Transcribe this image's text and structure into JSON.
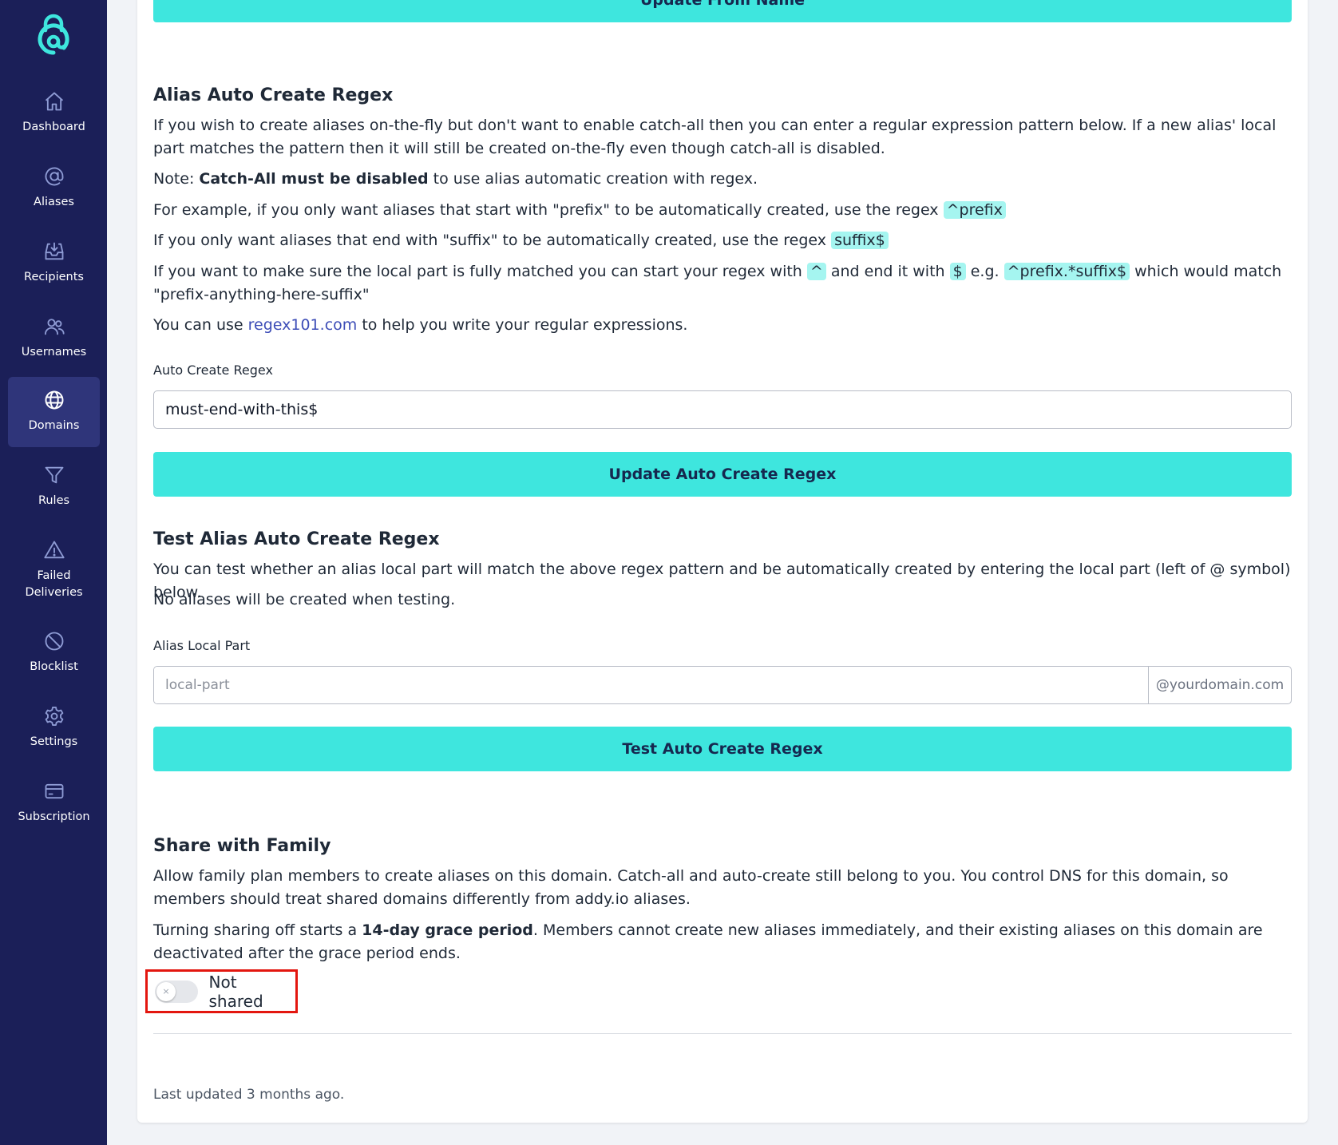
{
  "sidebar": {
    "logo": "addy-logo",
    "items": [
      {
        "label": "Dashboard",
        "icon": "home-icon"
      },
      {
        "label": "Aliases",
        "icon": "at-icon"
      },
      {
        "label": "Recipients",
        "icon": "inbox-icon"
      },
      {
        "label": "Usernames",
        "icon": "users-icon"
      },
      {
        "label": "Domains",
        "icon": "globe-icon",
        "active": true
      },
      {
        "label": "Rules",
        "icon": "funnel-icon"
      },
      {
        "label": "Failed Deliveries",
        "icon": "warning-icon"
      },
      {
        "label": "Blocklist",
        "icon": "ban-icon"
      },
      {
        "label": "Settings",
        "icon": "gear-icon"
      },
      {
        "label": "Subscription",
        "icon": "card-icon"
      }
    ]
  },
  "top_button": {
    "label": "Update From Name"
  },
  "auto_create": {
    "title": "Alias Auto Create Regex",
    "p1": "If you wish to create aliases on-the-fly but don't want to enable catch-all then you can enter a regular expression pattern below. If a new alias' local part matches the pattern then it will still be created on-the-fly even though catch-all is disabled.",
    "p2_prefix": "Note: ",
    "p2_bold": "Catch-All must be disabled",
    "p2_suffix": " to use alias automatic creation with regex.",
    "p3_text": "For example, if you only want aliases that start with \"prefix\" to be automatically created, use the regex ",
    "p3_code": "^prefix",
    "p4_text": "If you only want aliases that end with \"suffix\" to be automatically created, use the regex ",
    "p4_code": "suffix$",
    "p5_a": "If you want to make sure the local part is fully matched you can start your regex with ",
    "p5_code1": "^",
    "p5_b": " and end it with ",
    "p5_code2": "$",
    "p5_c": " e.g. ",
    "p5_code3": "^prefix.*suffix$",
    "p5_d": " which would match \"prefix-anything-here-suffix\"",
    "p6_prefix": "You can use ",
    "p6_link": "regex101.com",
    "p6_suffix": " to help you write your regular expressions.",
    "field_label": "Auto Create Regex",
    "field_value": "must-end-with-this$",
    "button": "Update Auto Create Regex"
  },
  "test_regex": {
    "title": "Test Alias Auto Create Regex",
    "p1": "You can test whether an alias local part will match the above regex pattern and be automatically created by entering the local part (left of @ symbol) below.",
    "p2": "No aliases will be created when testing.",
    "field_label": "Alias Local Part",
    "placeholder": "local-part",
    "addon": "@yourdomain.com",
    "button": "Test Auto Create Regex"
  },
  "share": {
    "title": "Share with Family",
    "p1": "Allow family plan members to create aliases on this domain. Catch-all and auto-create still belong to you. You control DNS for this domain, so members should treat shared domains differently from addy.io aliases.",
    "p2_prefix": "Turning sharing off starts a ",
    "p2_bold": "14-day grace period",
    "p2_suffix": ". Members cannot create new aliases immediately, and their existing aliases on this domain are deactivated after the grace period ends.",
    "toggle_label": "Not shared",
    "toggle_on": false,
    "knob_glyph": "×"
  },
  "footer": {
    "updated": "Last updated 3 months ago."
  },
  "colors": {
    "sidebar_bg": "#1b1f58",
    "sidebar_active": "#2f357a",
    "accent_button": "#3ee6de",
    "code_bg": "#a5f5f0",
    "link": "#3d4db7",
    "highlight_border": "#e3160f"
  }
}
